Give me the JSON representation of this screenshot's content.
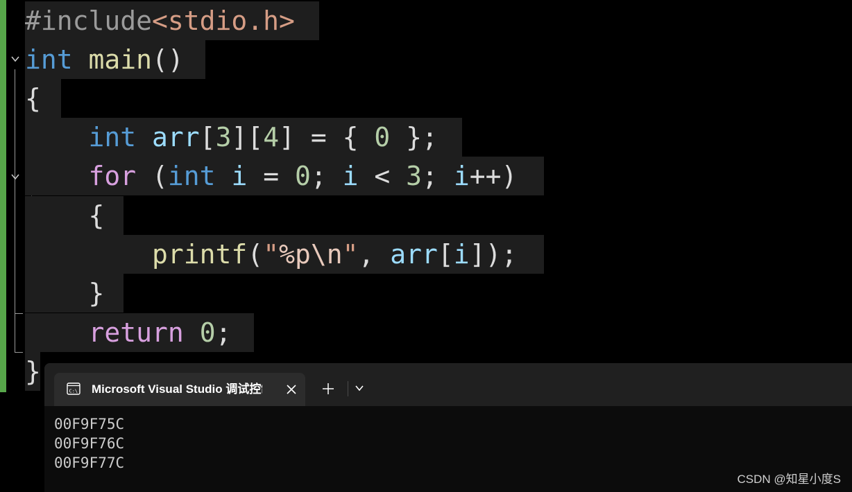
{
  "editor": {
    "lines": [
      [
        {
          "t": "#include",
          "c": "g"
        },
        {
          "t": "<stdio.h>",
          "c": "s"
        }
      ],
      [
        {
          "t": "int",
          "c": "k"
        },
        {
          "t": " ",
          "c": "p"
        },
        {
          "t": "main",
          "c": "f"
        },
        {
          "t": "()",
          "c": "p"
        }
      ],
      [
        {
          "t": "{",
          "c": "p"
        }
      ],
      [
        {
          "t": "    ",
          "c": "p"
        },
        {
          "t": "int",
          "c": "k"
        },
        {
          "t": " ",
          "c": "p"
        },
        {
          "t": "arr",
          "c": "v"
        },
        {
          "t": "[",
          "c": "p"
        },
        {
          "t": "3",
          "c": "n"
        },
        {
          "t": "][",
          "c": "p"
        },
        {
          "t": "4",
          "c": "n"
        },
        {
          "t": "] = { ",
          "c": "p"
        },
        {
          "t": "0",
          "c": "n"
        },
        {
          "t": " };",
          "c": "p"
        }
      ],
      [
        {
          "t": "    ",
          "c": "p"
        },
        {
          "t": "for",
          "c": "c"
        },
        {
          "t": " (",
          "c": "p"
        },
        {
          "t": "int",
          "c": "k"
        },
        {
          "t": " ",
          "c": "p"
        },
        {
          "t": "i",
          "c": "v"
        },
        {
          "t": " = ",
          "c": "p"
        },
        {
          "t": "0",
          "c": "n"
        },
        {
          "t": "; ",
          "c": "p"
        },
        {
          "t": "i",
          "c": "v"
        },
        {
          "t": " < ",
          "c": "p"
        },
        {
          "t": "3",
          "c": "n"
        },
        {
          "t": "; ",
          "c": "p"
        },
        {
          "t": "i",
          "c": "v"
        },
        {
          "t": "++)",
          "c": "p"
        }
      ],
      [
        {
          "t": "    {",
          "c": "p"
        }
      ],
      [
        {
          "t": "        ",
          "c": "p"
        },
        {
          "t": "printf",
          "c": "f"
        },
        {
          "t": "(",
          "c": "p"
        },
        {
          "t": "\"",
          "c": "s"
        },
        {
          "t": "%p\\n",
          "c": "e"
        },
        {
          "t": "\"",
          "c": "s"
        },
        {
          "t": ", ",
          "c": "p"
        },
        {
          "t": "arr",
          "c": "v"
        },
        {
          "t": "[",
          "c": "p"
        },
        {
          "t": "i",
          "c": "v"
        },
        {
          "t": "]);",
          "c": "p"
        }
      ],
      [
        {
          "t": "    }",
          "c": "p"
        }
      ],
      [
        {
          "t": "    ",
          "c": "p"
        },
        {
          "t": "return",
          "c": "c"
        },
        {
          "t": " ",
          "c": "p"
        },
        {
          "t": "0",
          "c": "n"
        },
        {
          "t": ";",
          "c": "p"
        }
      ],
      [
        {
          "t": "}",
          "c": "p"
        }
      ]
    ],
    "fold_icons": [
      "chevron-down-icon",
      "chevron-down-icon"
    ]
  },
  "terminal": {
    "tab": {
      "title": "Microsoft Visual Studio 调试控制台",
      "icon": "console-icon",
      "close_icon": "close-icon"
    },
    "new_tab_icon": "plus-icon",
    "dropdown_icon": "chevron-down-icon",
    "output": [
      "00F9F75C",
      "00F9F76C",
      "00F9F77C"
    ]
  },
  "watermark": "CSDN @知星小度S",
  "colors": {
    "editor_background": "#000000",
    "line_highlight": "#1e1e1e",
    "change_bar": "#57a64a",
    "keyword": "#569cd6",
    "control_keyword": "#d8a0df",
    "function": "#dcdcaa",
    "variable": "#9cdcfe",
    "number": "#b5cea8",
    "string": "#d69d85",
    "terminal_tabbar": "#202020",
    "terminal_tab": "#2c2c2c",
    "console_background": "#0c0c0c"
  }
}
